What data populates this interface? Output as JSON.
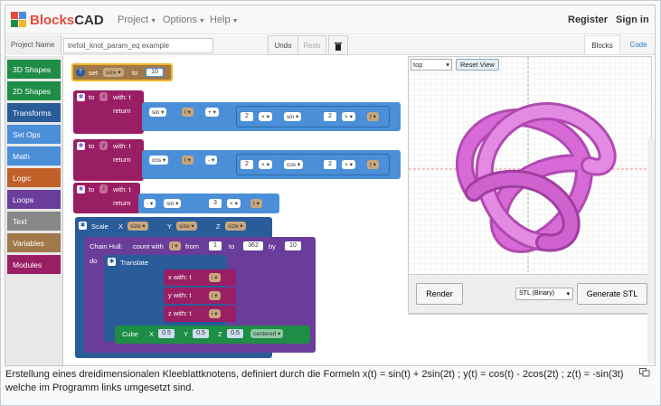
{
  "app": {
    "logo_prefix": "Blocks",
    "logo_suffix": "CAD"
  },
  "navbar": {
    "menus": [
      "Project",
      "Options",
      "Help"
    ],
    "register": "Register",
    "signin": "Sign in"
  },
  "toolbar": {
    "project_name_label": "Project Name",
    "project_name_value": "trefoil_knot_param_eq example",
    "undo": "Undo",
    "redo": "Redo",
    "tab_blocks": "Blocks",
    "tab_code": "Code"
  },
  "categories": [
    {
      "label": "3D Shapes",
      "color": "#1e8d45"
    },
    {
      "label": "2D Shapes",
      "color": "#1e8d45"
    },
    {
      "label": "Transforms",
      "color": "#2a5c9a"
    },
    {
      "label": "Set Ops",
      "color": "#4a8fd8"
    },
    {
      "label": "Math",
      "color": "#4a8fd8"
    },
    {
      "label": "Logic",
      "color": "#c2602a"
    },
    {
      "label": "Loops",
      "color": "#6a3d9a"
    },
    {
      "label": "Text",
      "color": "#888888"
    },
    {
      "label": "Variables",
      "color": "#a0784a"
    },
    {
      "label": "Modules",
      "color": "#9a1e63"
    }
  ],
  "blocks": {
    "set": {
      "label": "set",
      "var": "size",
      "to": "to",
      "value": "10"
    },
    "fx": {
      "to": "to",
      "name": "x",
      "with": "with: t",
      "return": "return",
      "fn1": "sin",
      "t": "t",
      "op": "+",
      "two": "2",
      "times": "×",
      "fn2": "sin",
      "two_b": "2"
    },
    "fy": {
      "to": "to",
      "name": "y",
      "with": "with: t",
      "return": "return",
      "fn1": "cos",
      "t": "t",
      "op": "-",
      "two": "2",
      "times": "×",
      "fn2": "cos",
      "two_b": "2"
    },
    "fz": {
      "to": "to",
      "name": "z",
      "with": "with: t",
      "return": "return",
      "neg": "-",
      "fn": "sin",
      "three": "3",
      "times": "×",
      "t": "t"
    },
    "scale": {
      "label": "Scale",
      "x": "X",
      "y": "Y",
      "z": "Z",
      "size": "size"
    },
    "hull": {
      "label": "Chain Hull:",
      "count": "count with",
      "i": "i",
      "from": "from",
      "from_val": "1",
      "to": "to",
      "to_val": "362",
      "by": "by",
      "by_val": "10",
      "do": "do"
    },
    "translate": {
      "label": "Translate",
      "x": "X",
      "y": "Y",
      "z": "Z",
      "xf": "x with: t",
      "yf": "y with: t",
      "zf": "z with: t",
      "i": "i"
    },
    "cube": {
      "label": "Cube",
      "x": "X",
      "y": "Y",
      "z": "Z",
      "xv": "0.5",
      "yv": "0.5",
      "zv": "0.5",
      "mode": "centered"
    }
  },
  "view": {
    "camera": "top",
    "reset": "Reset View",
    "render": "Render",
    "format": "STL (Binary)",
    "generate": "Generate STL",
    "knot_color": "#d86ad8"
  },
  "caption": "Erstellung eines dreidimensionalen Kleeblattknotens, definiert durch die Formeln x(t) = sin(t) + 2sin(2t) ; y(t) = cos(t) - 2cos(2t) ; z(t) = -sin(3t) welche im Programm links umgesetzt sind."
}
